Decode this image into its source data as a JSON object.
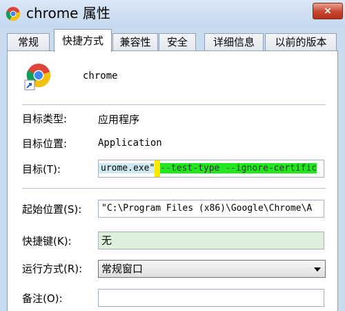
{
  "window": {
    "title": "chrome 属性",
    "close_label": "×"
  },
  "tabs": [
    {
      "label": "常规",
      "active": false
    },
    {
      "label": "快捷方式",
      "active": true
    },
    {
      "label": "兼容性",
      "active": false
    },
    {
      "label": "安全",
      "active": false
    },
    {
      "label": "详细信息",
      "active": false
    },
    {
      "label": "以前的版本",
      "active": false
    }
  ],
  "shortcut": {
    "name": "chrome",
    "target_type_label": "目标类型:",
    "target_type_value": "应用程序",
    "target_location_label": "目标位置:",
    "target_location_value": "Application",
    "target_label": "目标(T):",
    "target_value_visible": "urome.exe\"",
    "target_args": "--test-type --ignore-certific",
    "start_in_label": "起始位置(S):",
    "start_in_value": "\"C:\\Program Files (x86)\\Google\\Chrome\\A",
    "hotkey_label": "快捷键(K):",
    "hotkey_value": "无",
    "run_label": "运行方式(R):",
    "run_value": "常规窗口",
    "comment_label": "备注(O):",
    "comment_value": ""
  },
  "colors": {
    "arg_highlight": "#22e620",
    "quote_highlight": "#ffe800",
    "hotkey_bg": "#ddf0dc"
  }
}
